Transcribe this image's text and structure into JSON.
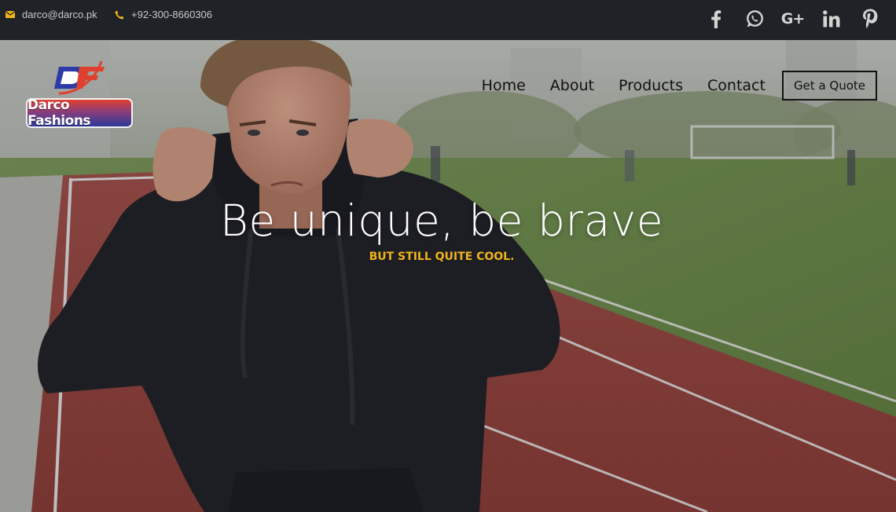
{
  "topbar": {
    "email": "darco@darco.pk",
    "phone": "+92-300-8660306",
    "accent_color": "#f0b31b",
    "social": [
      {
        "name": "facebook-icon"
      },
      {
        "name": "whatsapp-icon"
      },
      {
        "name": "google-plus-icon",
        "glyph": "G+"
      },
      {
        "name": "linkedin-icon"
      },
      {
        "name": "pinterest-icon"
      }
    ]
  },
  "brand": {
    "name": "Darco Fashions",
    "monogram": "DF"
  },
  "nav": {
    "items": [
      "Home",
      "About",
      "Products",
      "Contact"
    ],
    "cta": "Get a Quote"
  },
  "hero": {
    "headline": "Be unique, be brave",
    "tagline": "BUT STILL QUITE COOL.",
    "tagline_color": "#f0b31b"
  }
}
